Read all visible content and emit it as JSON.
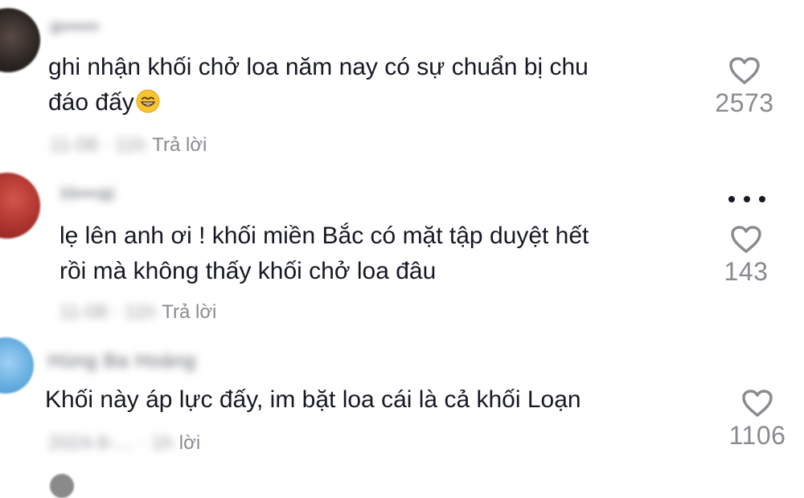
{
  "comments": [
    {
      "username": "a•••••",
      "text_line1": "ghi nhận khối chở loa năm nay có sự chuẩn bị chu",
      "text_line2": "đáo đấy",
      "emoji": "grinning-face-with-smiling-eyes",
      "date": "11-08 · 11h",
      "reply_label": "Trả lời",
      "likes": "2573",
      "has_more_menu": false
    },
    {
      "username": "H•••ai",
      "text_line1": "lẹ lên anh ơi ! khối miền Bắc có mặt tập duyệt hết",
      "text_line2": "rồi mà không thấy khối chở loa đâu",
      "date": "11-08 · 11h",
      "reply_label": "Trả lời",
      "likes": "143",
      "has_more_menu": true
    },
    {
      "username": "Hùng Ba Hoàng",
      "text_line1": "Khối này áp lực đấy, im bặt loa cái là cả khối Loạn",
      "date": "2024-8-… · 1h",
      "reply_label": "lời",
      "likes": "1106",
      "has_more_menu": false
    }
  ],
  "colors": {
    "text": "#161823",
    "secondary": "#8a8b91",
    "background": "#ffffff"
  },
  "icons": {
    "like": "heart-outline-icon",
    "more": "more-horizontal-icon"
  }
}
